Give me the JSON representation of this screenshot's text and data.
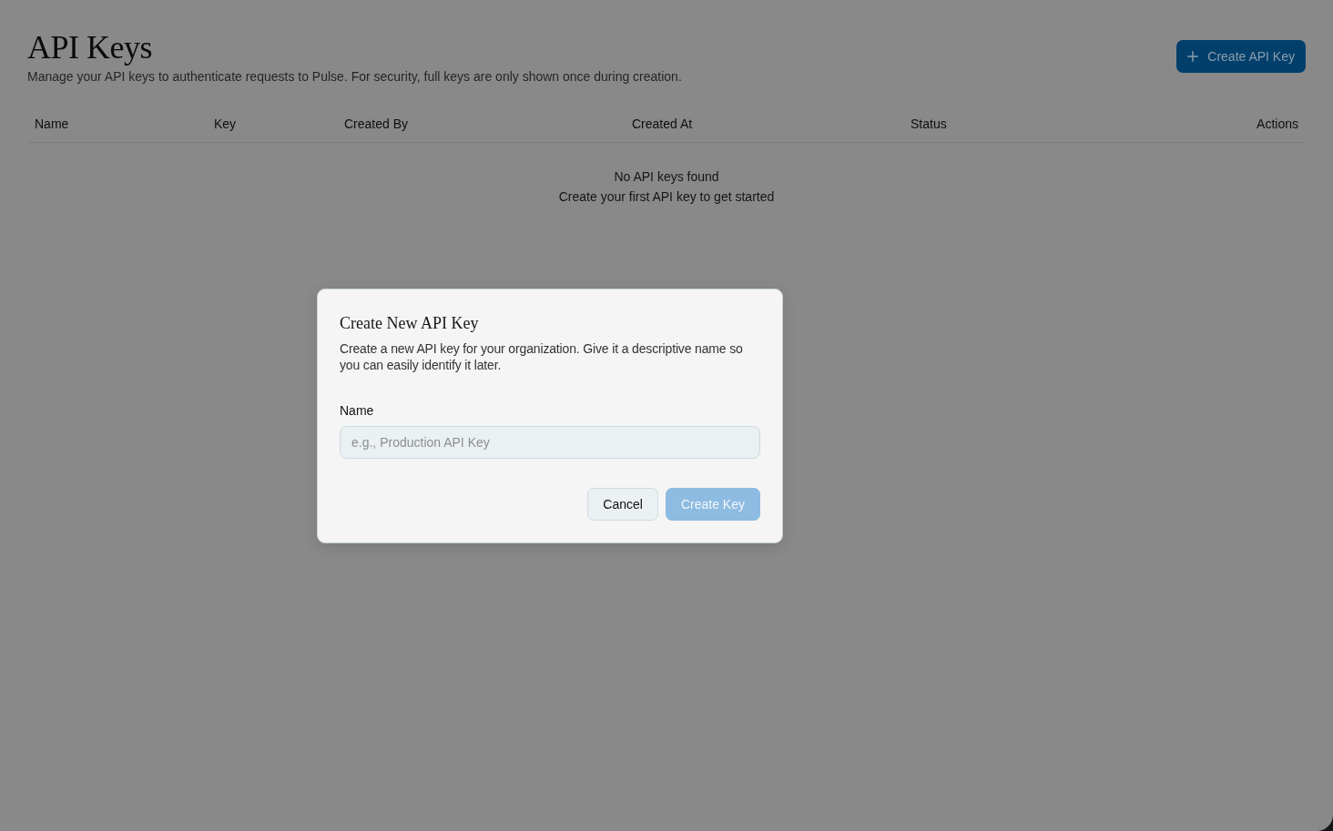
{
  "page": {
    "title": "API Keys",
    "description": "Manage your API keys to authenticate requests to Pulse. For security, full keys are only shown once during creation.",
    "create_button": {
      "label": "Create API Key"
    }
  },
  "table": {
    "columns": [
      {
        "label": "Name"
      },
      {
        "label": "Key"
      },
      {
        "label": "Created By"
      },
      {
        "label": "Created At"
      },
      {
        "label": "Status"
      },
      {
        "label": "Actions"
      }
    ],
    "empty_state": {
      "title": "No API keys found",
      "subtitle": "Create your first API key to get started"
    }
  },
  "dialog": {
    "title": "Create New API Key",
    "description": "Create a new API key for your organization. Give it a descriptive name so you can easily identify it later.",
    "field": {
      "label": "Name",
      "placeholder": "e.g., Production API Key"
    },
    "buttons": [
      {
        "label": "Cancel",
        "kind": "secondary",
        "disabled": false
      },
      {
        "label": "Create Key",
        "kind": "primary",
        "disabled": true
      }
    ]
  }
}
